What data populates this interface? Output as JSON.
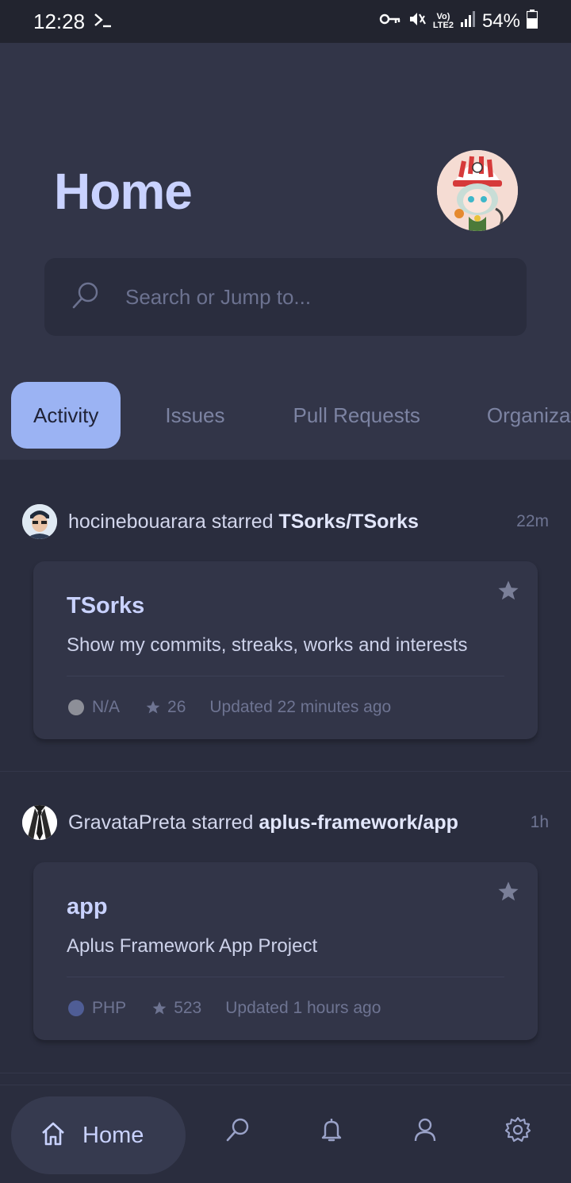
{
  "status_bar": {
    "time": "12:28",
    "volte": "Vo)",
    "lte": "LTE2",
    "battery": "54%"
  },
  "header": {
    "title": "Home",
    "avatar_icon": "anime-character-avatar"
  },
  "search": {
    "placeholder": "Search or Jump to..."
  },
  "tabs": [
    {
      "label": "Activity",
      "active": true
    },
    {
      "label": "Issues",
      "active": false
    },
    {
      "label": "Pull Requests",
      "active": false
    },
    {
      "label": "Organizations",
      "active": false
    }
  ],
  "feed": [
    {
      "actor": "hocinebouarara",
      "action": "starred",
      "repo_full": "TSorks/TSorks",
      "time": "22m",
      "repo": {
        "name": "TSorks",
        "description": "Show my commits, streaks, works and interests",
        "language": "N/A",
        "language_color": "#8d8f98",
        "stars": "26",
        "updated": "Updated 22 minutes ago"
      }
    },
    {
      "actor": "GravataPreta",
      "action": "starred",
      "repo_full": "aplus-framework/app",
      "time": "1h",
      "repo": {
        "name": "app",
        "description": "Aplus Framework App Project",
        "language": "PHP",
        "language_color": "#4f5d95",
        "stars": "523",
        "updated": "Updated 1 hours ago"
      }
    }
  ],
  "bottom_nav": {
    "home_label": "Home",
    "items": [
      "home-icon",
      "search-icon",
      "bell-icon",
      "profile-icon",
      "gear-icon"
    ]
  },
  "colors": {
    "accent": "#9bb3f3",
    "background": "#2a2d3e",
    "surface": "#323548",
    "title": "#c9d2ff"
  }
}
